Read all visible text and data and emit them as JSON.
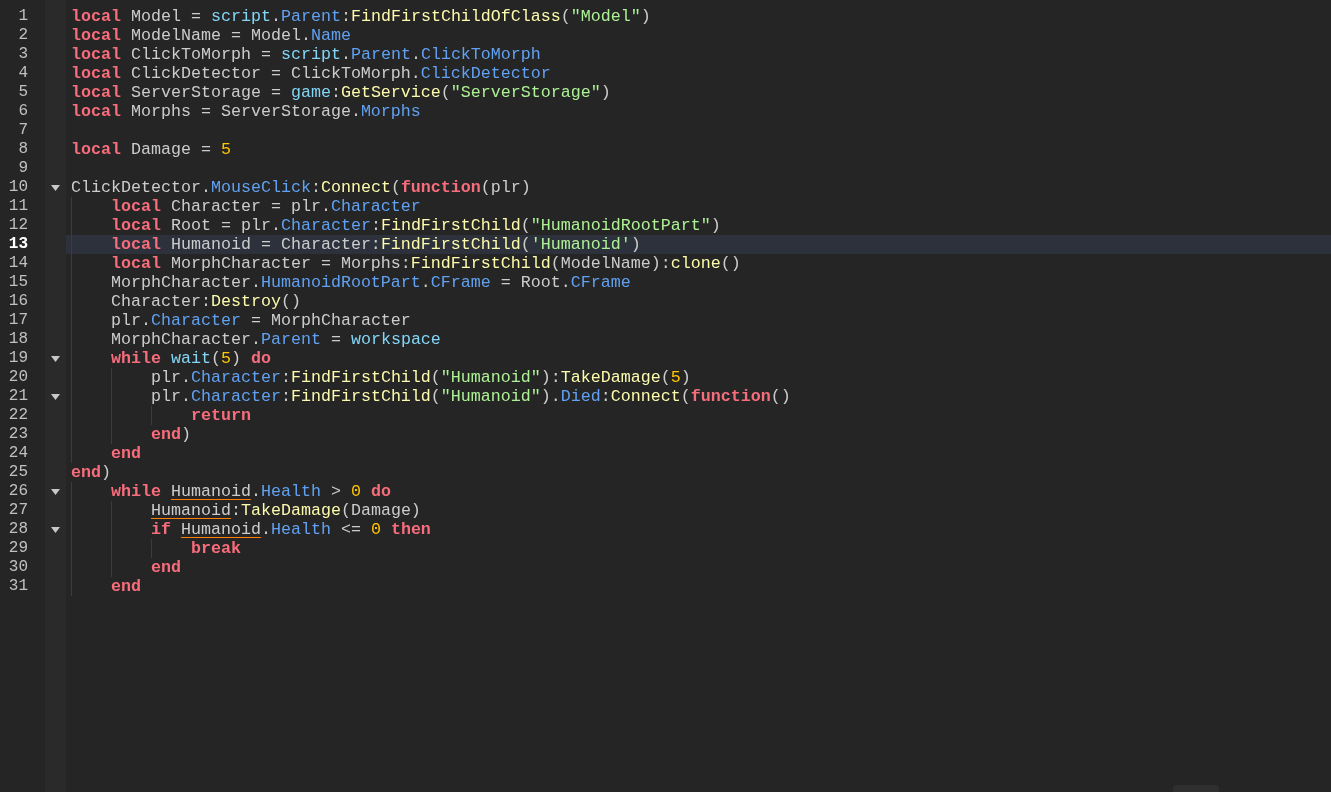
{
  "editor": {
    "lines": [
      {
        "number": "1",
        "fold": false,
        "current": false,
        "tokens": [
          {
            "kind": "kw",
            "text": "local"
          },
          {
            "kind": "plain",
            "text": " Model = "
          },
          {
            "kind": "bi",
            "text": "script"
          },
          {
            "kind": "plain",
            "text": "."
          },
          {
            "kind": "prop",
            "text": "Parent"
          },
          {
            "kind": "plain",
            "text": ":"
          },
          {
            "kind": "fn",
            "text": "FindFirstChildOfClass"
          },
          {
            "kind": "plain",
            "text": "("
          },
          {
            "kind": "str",
            "text": "\"Model\""
          },
          {
            "kind": "plain",
            "text": ")"
          }
        ]
      },
      {
        "number": "2",
        "fold": false,
        "current": false,
        "tokens": [
          {
            "kind": "kw",
            "text": "local"
          },
          {
            "kind": "plain",
            "text": " ModelName = Model."
          },
          {
            "kind": "prop",
            "text": "Name"
          }
        ]
      },
      {
        "number": "3",
        "fold": false,
        "current": false,
        "tokens": [
          {
            "kind": "kw",
            "text": "local"
          },
          {
            "kind": "plain",
            "text": " ClickToMorph = "
          },
          {
            "kind": "bi",
            "text": "script"
          },
          {
            "kind": "plain",
            "text": "."
          },
          {
            "kind": "prop",
            "text": "Parent"
          },
          {
            "kind": "plain",
            "text": "."
          },
          {
            "kind": "prop",
            "text": "ClickToMorph"
          }
        ]
      },
      {
        "number": "4",
        "fold": false,
        "current": false,
        "tokens": [
          {
            "kind": "kw",
            "text": "local"
          },
          {
            "kind": "plain",
            "text": " ClickDetector = ClickToMorph."
          },
          {
            "kind": "prop",
            "text": "ClickDetector"
          }
        ]
      },
      {
        "number": "5",
        "fold": false,
        "current": false,
        "tokens": [
          {
            "kind": "kw",
            "text": "local"
          },
          {
            "kind": "plain",
            "text": " ServerStorage = "
          },
          {
            "kind": "bi",
            "text": "game"
          },
          {
            "kind": "plain",
            "text": ":"
          },
          {
            "kind": "fn",
            "text": "GetService"
          },
          {
            "kind": "plain",
            "text": "("
          },
          {
            "kind": "str",
            "text": "\"ServerStorage\""
          },
          {
            "kind": "plain",
            "text": ")"
          }
        ]
      },
      {
        "number": "6",
        "fold": false,
        "current": false,
        "tokens": [
          {
            "kind": "kw",
            "text": "local"
          },
          {
            "kind": "plain",
            "text": " Morphs = ServerStorage."
          },
          {
            "kind": "prop",
            "text": "Morphs"
          }
        ]
      },
      {
        "number": "7",
        "fold": false,
        "current": false
      },
      {
        "number": "8",
        "fold": false,
        "current": false,
        "tokens": [
          {
            "kind": "kw",
            "text": "local"
          },
          {
            "kind": "plain",
            "text": " Damage = "
          },
          {
            "kind": "num",
            "text": "5"
          }
        ]
      },
      {
        "number": "9",
        "fold": false,
        "current": false
      },
      {
        "number": "10",
        "fold": true,
        "current": false,
        "tokens": [
          {
            "kind": "plain",
            "text": "ClickDetector."
          },
          {
            "kind": "prop",
            "text": "MouseClick"
          },
          {
            "kind": "plain",
            "text": ":"
          },
          {
            "kind": "fn",
            "text": "Connect"
          },
          {
            "kind": "plain",
            "text": "("
          },
          {
            "kind": "kw",
            "text": "function"
          },
          {
            "kind": "plain",
            "text": "(plr)"
          }
        ]
      },
      {
        "number": "11",
        "fold": false,
        "current": false,
        "tokens": [
          {
            "kind": "kw",
            "text": "    local"
          },
          {
            "kind": "plain",
            "text": " Character = plr."
          },
          {
            "kind": "prop",
            "text": "Character"
          }
        ]
      },
      {
        "number": "12",
        "fold": false,
        "current": false,
        "tokens": [
          {
            "kind": "kw",
            "text": "    local"
          },
          {
            "kind": "plain",
            "text": " Root = plr."
          },
          {
            "kind": "prop",
            "text": "Character"
          },
          {
            "kind": "plain",
            "text": ":"
          },
          {
            "kind": "fn",
            "text": "FindFirstChild"
          },
          {
            "kind": "plain",
            "text": "("
          },
          {
            "kind": "str",
            "text": "\"HumanoidRootPart\""
          },
          {
            "kind": "plain",
            "text": ")"
          }
        ]
      },
      {
        "number": "13",
        "fold": false,
        "current": true,
        "tokens": [
          {
            "kind": "kw",
            "text": "    local"
          },
          {
            "kind": "plain",
            "text": " Humanoid = Character:"
          },
          {
            "kind": "fn",
            "text": "FindFirstChild"
          },
          {
            "kind": "plain",
            "text": "("
          },
          {
            "kind": "str",
            "text": "'Humanoid'"
          },
          {
            "kind": "plain",
            "text": ")"
          }
        ]
      },
      {
        "number": "14",
        "fold": false,
        "current": false,
        "tokens": [
          {
            "kind": "kw",
            "text": "    local"
          },
          {
            "kind": "plain",
            "text": " MorphCharacter = Morphs:"
          },
          {
            "kind": "fn",
            "text": "FindFirstChild"
          },
          {
            "kind": "plain",
            "text": "(ModelName):"
          },
          {
            "kind": "fn",
            "text": "clone"
          },
          {
            "kind": "plain",
            "text": "()"
          }
        ]
      },
      {
        "number": "15",
        "fold": false,
        "current": false,
        "tokens": [
          {
            "kind": "plain",
            "text": "    MorphCharacter."
          },
          {
            "kind": "prop",
            "text": "HumanoidRootPart"
          },
          {
            "kind": "plain",
            "text": "."
          },
          {
            "kind": "prop",
            "text": "CFrame"
          },
          {
            "kind": "plain",
            "text": " = Root."
          },
          {
            "kind": "prop",
            "text": "CFrame"
          }
        ]
      },
      {
        "number": "16",
        "fold": false,
        "current": false,
        "tokens": [
          {
            "kind": "plain",
            "text": "    Character:"
          },
          {
            "kind": "fn",
            "text": "Destroy"
          },
          {
            "kind": "plain",
            "text": "()"
          }
        ]
      },
      {
        "number": "17",
        "fold": false,
        "current": false,
        "tokens": [
          {
            "kind": "plain",
            "text": "    plr."
          },
          {
            "kind": "prop",
            "text": "Character"
          },
          {
            "kind": "plain",
            "text": " = MorphCharacter"
          }
        ]
      },
      {
        "number": "18",
        "fold": false,
        "current": false,
        "tokens": [
          {
            "kind": "plain",
            "text": "    MorphCharacter."
          },
          {
            "kind": "prop",
            "text": "Parent"
          },
          {
            "kind": "plain",
            "text": " = "
          },
          {
            "kind": "bi",
            "text": "workspace"
          }
        ]
      },
      {
        "number": "19",
        "fold": true,
        "current": false,
        "tokens": [
          {
            "kind": "kw",
            "text": "    while"
          },
          {
            "kind": "bi",
            "text": " wait"
          },
          {
            "kind": "plain",
            "text": "("
          },
          {
            "kind": "num",
            "text": "5"
          },
          {
            "kind": "plain",
            "text": ")"
          },
          {
            "kind": "kw",
            "text": " do"
          }
        ]
      },
      {
        "number": "20",
        "fold": false,
        "current": false,
        "tokens": [
          {
            "kind": "plain",
            "text": "        plr."
          },
          {
            "kind": "prop",
            "text": "Character"
          },
          {
            "kind": "plain",
            "text": ":"
          },
          {
            "kind": "fn",
            "text": "FindFirstChild"
          },
          {
            "kind": "plain",
            "text": "("
          },
          {
            "kind": "str",
            "text": "\"Humanoid\""
          },
          {
            "kind": "plain",
            "text": "):"
          },
          {
            "kind": "fn",
            "text": "TakeDamage"
          },
          {
            "kind": "plain",
            "text": "("
          },
          {
            "kind": "num",
            "text": "5"
          },
          {
            "kind": "plain",
            "text": ")"
          }
        ]
      },
      {
        "number": "21",
        "fold": true,
        "current": false,
        "tokens": [
          {
            "kind": "plain",
            "text": "        plr."
          },
          {
            "kind": "prop",
            "text": "Character"
          },
          {
            "kind": "plain",
            "text": ":"
          },
          {
            "kind": "fn",
            "text": "FindFirstChild"
          },
          {
            "kind": "plain",
            "text": "("
          },
          {
            "kind": "str",
            "text": "\"Humanoid\""
          },
          {
            "kind": "plain",
            "text": ")."
          },
          {
            "kind": "prop",
            "text": "Died"
          },
          {
            "kind": "plain",
            "text": ":"
          },
          {
            "kind": "fn",
            "text": "Connect"
          },
          {
            "kind": "plain",
            "text": "("
          },
          {
            "kind": "kw",
            "text": "function"
          },
          {
            "kind": "plain",
            "text": "()"
          }
        ]
      },
      {
        "number": "22",
        "fold": false,
        "current": false,
        "tokens": [
          {
            "kind": "kw",
            "text": "            return"
          }
        ]
      },
      {
        "number": "23",
        "fold": false,
        "current": false,
        "tokens": [
          {
            "kind": "kw",
            "text": "        end"
          },
          {
            "kind": "plain",
            "text": ")"
          }
        ]
      },
      {
        "number": "24",
        "fold": false,
        "current": false,
        "tokens": [
          {
            "kind": "kw",
            "text": "    end"
          }
        ]
      },
      {
        "number": "25",
        "fold": false,
        "current": false,
        "tokens": [
          {
            "kind": "kw",
            "text": "end"
          },
          {
            "kind": "plain",
            "text": ")"
          }
        ]
      },
      {
        "number": "26",
        "fold": true,
        "current": false,
        "tokens": [
          {
            "kind": "kw",
            "text": "    while "
          },
          {
            "kind": "warn",
            "text": "Humanoid"
          },
          {
            "kind": "plain",
            "text": "."
          },
          {
            "kind": "prop",
            "text": "Health"
          },
          {
            "kind": "plain",
            "text": " > "
          },
          {
            "kind": "num",
            "text": "0"
          },
          {
            "kind": "kw",
            "text": " do"
          }
        ]
      },
      {
        "number": "27",
        "fold": false,
        "current": false,
        "tokens": [
          {
            "kind": "warn",
            "text": "        Humanoid"
          },
          {
            "kind": "plain",
            "text": ":"
          },
          {
            "kind": "fn",
            "text": "TakeDamage"
          },
          {
            "kind": "plain",
            "text": "(Damage)"
          }
        ]
      },
      {
        "number": "28",
        "fold": true,
        "current": false,
        "tokens": [
          {
            "kind": "kw",
            "text": "        if "
          },
          {
            "kind": "warn",
            "text": "Humanoid"
          },
          {
            "kind": "plain",
            "text": "."
          },
          {
            "kind": "prop",
            "text": "Health"
          },
          {
            "kind": "plain",
            "text": " <= "
          },
          {
            "kind": "num",
            "text": "0"
          },
          {
            "kind": "kw",
            "text": " then"
          }
        ]
      },
      {
        "number": "29",
        "fold": false,
        "current": false,
        "tokens": [
          {
            "kind": "kw",
            "text": "            break"
          }
        ]
      },
      {
        "number": "30",
        "fold": false,
        "current": false,
        "tokens": [
          {
            "kind": "kw",
            "text": "        end"
          }
        ]
      },
      {
        "number": "31",
        "fold": false,
        "current": false,
        "tokens": [
          {
            "kind": "kw",
            "text": "    end"
          }
        ]
      }
    ]
  }
}
